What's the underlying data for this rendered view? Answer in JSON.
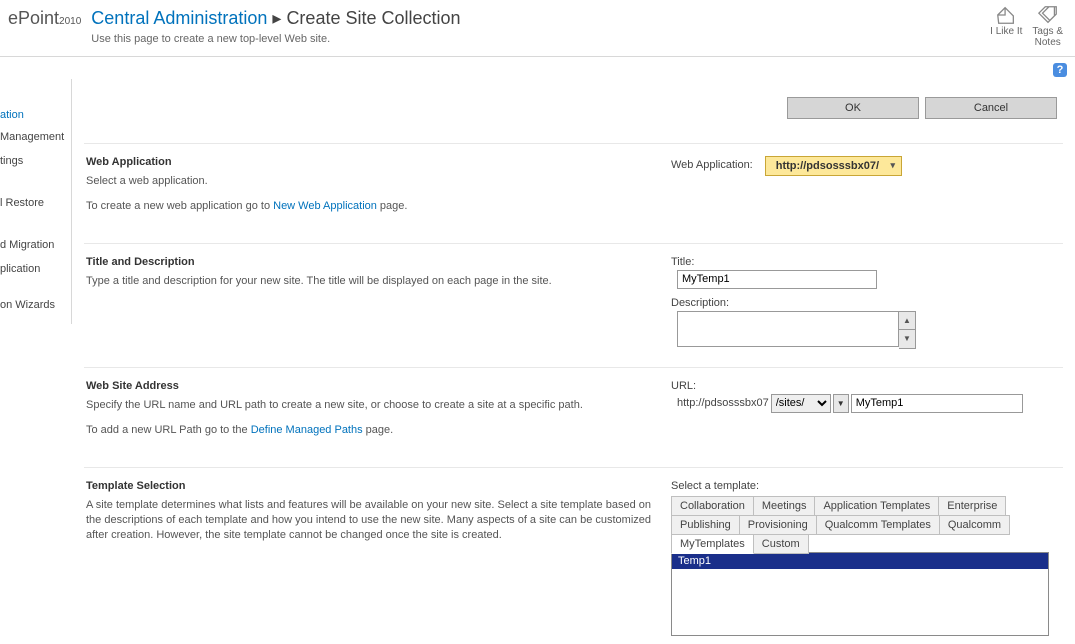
{
  "header": {
    "logo_prefix": "ePoint",
    "logo_year": "2010",
    "breadcrumb_parent": "Central Administration",
    "breadcrumb_sep": " ▸ ",
    "breadcrumb_current": "Create Site Collection",
    "subtitle": "Use this page to create a new top-level Web site.",
    "like_label": "I Like It",
    "tags_label": "Tags &\nNotes"
  },
  "sidebar": {
    "heading": "ation",
    "items": [
      "Management",
      "tings",
      "l Restore",
      "d Migration",
      "plication",
      "on Wizards"
    ]
  },
  "buttons": {
    "ok": "OK",
    "cancel": "Cancel"
  },
  "sections": {
    "webapp": {
      "title": "Web Application",
      "desc1": "Select a web application.",
      "desc2a": "To create a new web application go to ",
      "link": "New Web Application",
      "desc2b": " page.",
      "field_label": "Web Application:",
      "selected": "http://pdsosssbx07/"
    },
    "titledesc": {
      "title": "Title and Description",
      "desc": "Type a title and description for your new site. The title will be displayed on each page in the site.",
      "title_label": "Title:",
      "title_value": "MyTemp1",
      "desc_label": "Description:",
      "desc_value": ""
    },
    "address": {
      "title": "Web Site Address",
      "desc1": "Specify the URL name and URL path to create a new site, or choose to create a site at a specific path.",
      "desc2a": "To add a new URL Path go to the ",
      "link": "Define Managed Paths",
      "desc2b": " page.",
      "url_label": "URL:",
      "url_prefix": "http://pdsosssbx07",
      "path_option": "/sites/",
      "url_value": "MyTemp1"
    },
    "template": {
      "title": "Template Selection",
      "desc": "A site template determines what lists and features will be available on your new site. Select a site template based on the descriptions of each template and how you intend to use the new site. Many aspects of a site can be customized after creation. However, the site template cannot be changed once the site is created.",
      "select_label": "Select a template:",
      "tabs": [
        "Collaboration",
        "Meetings",
        "Application Templates",
        "Enterprise",
        "Publishing",
        "Provisioning",
        "Qualcomm Templates",
        "Qualcomm",
        "MyTemplates",
        "Custom"
      ],
      "active_tab": "MyTemplates",
      "item": "Temp1"
    }
  }
}
